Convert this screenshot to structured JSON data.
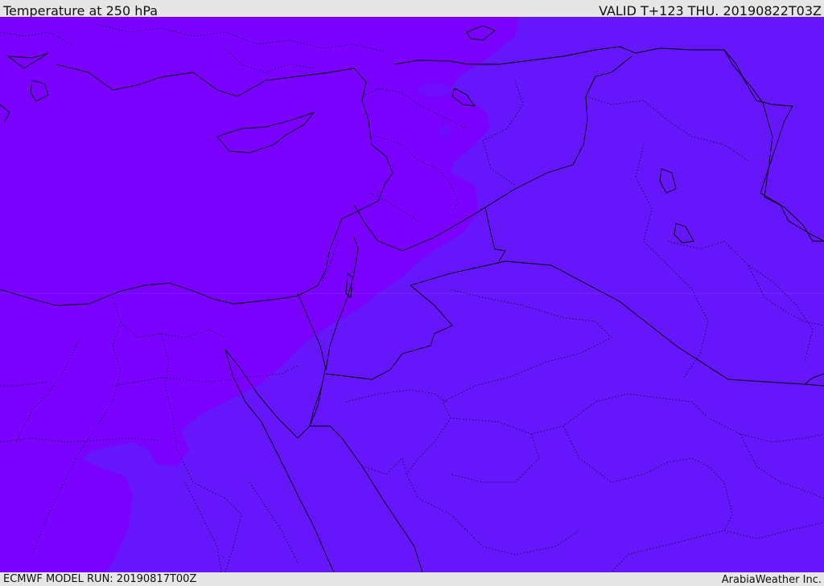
{
  "header": {
    "title": "Temperature at 250 hPa",
    "valid": "VALID T+123 THU. 20190822T03Z"
  },
  "footer": {
    "model_run": "ECMWF MODEL RUN: 20190817T00Z",
    "credit": "ArabiaWeather Inc."
  },
  "map": {
    "field": "temperature",
    "level": "250 hPa",
    "colors": {
      "warm_band": "#7a00ff",
      "cool_band": "#6616fb",
      "coastline": "#000000",
      "border": "#000000"
    }
  }
}
